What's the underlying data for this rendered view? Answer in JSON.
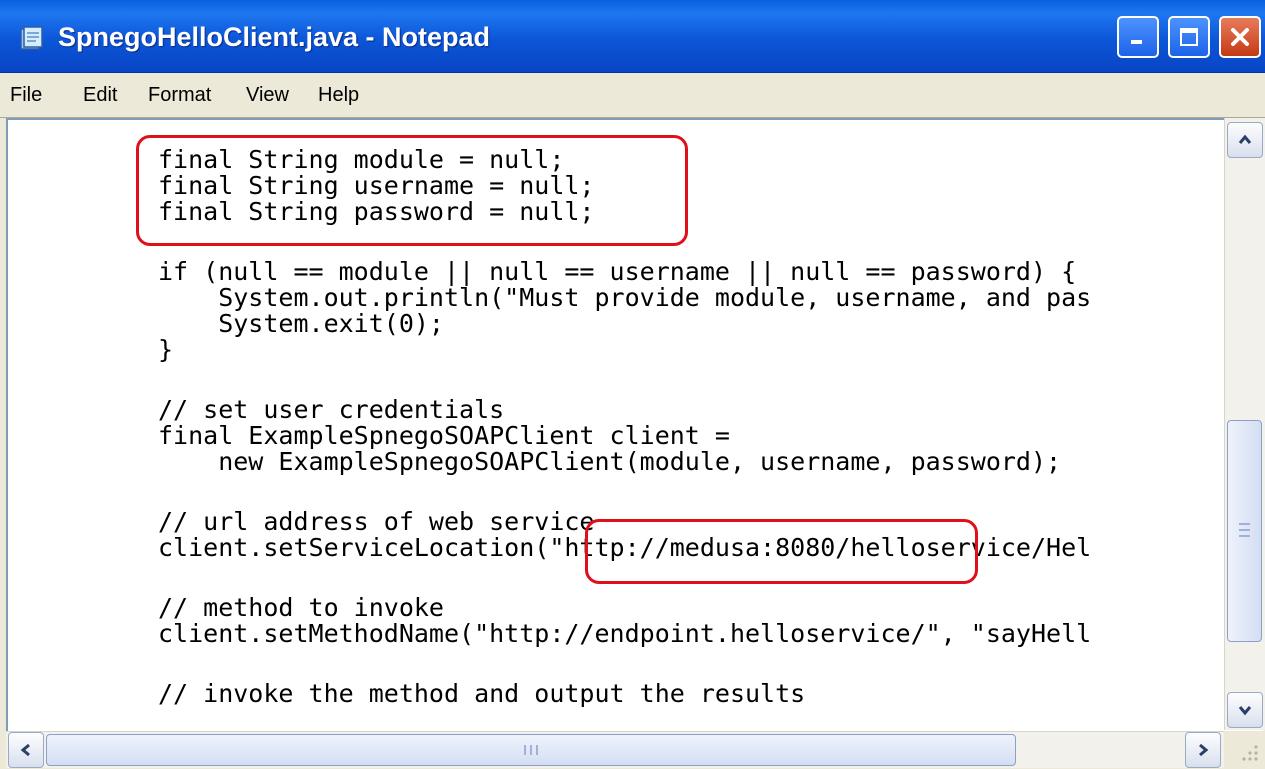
{
  "window": {
    "title": "SpnegoHelloClient.java - Notepad",
    "app_icon": "notepad-icon",
    "buttons": {
      "minimize": "minimize-icon",
      "maximize": "maximize-icon",
      "close": "close-icon"
    }
  },
  "menubar": {
    "items": [
      {
        "label": "File"
      },
      {
        "label": "Edit"
      },
      {
        "label": "Format"
      },
      {
        "label": "View"
      },
      {
        "label": "Help"
      }
    ]
  },
  "editor": {
    "lines": [
      "final String module = null;",
      "final String username = null;",
      "final String password = null;",
      "if (null == module || null == username || null == password) {",
      "    System.out.println(\"Must provide module, username, and pas",
      "    System.exit(0);",
      "}",
      "// set user credentials",
      "final ExampleSpnegoSOAPClient client =",
      "    new ExampleSpnegoSOAPClient(module, username, password);",
      "// url address of web service",
      "client.setServiceLocation(\"http://medusa:8080/helloservice/Hel",
      "// method to invoke",
      "client.setMethodName(\"http://endpoint.helloservice/\", \"sayHell",
      "// invoke the method and output the results"
    ]
  },
  "colors": {
    "titlebar": "#0a5fe0",
    "annotation": "#e0101a",
    "close_button": "#c53a16"
  }
}
